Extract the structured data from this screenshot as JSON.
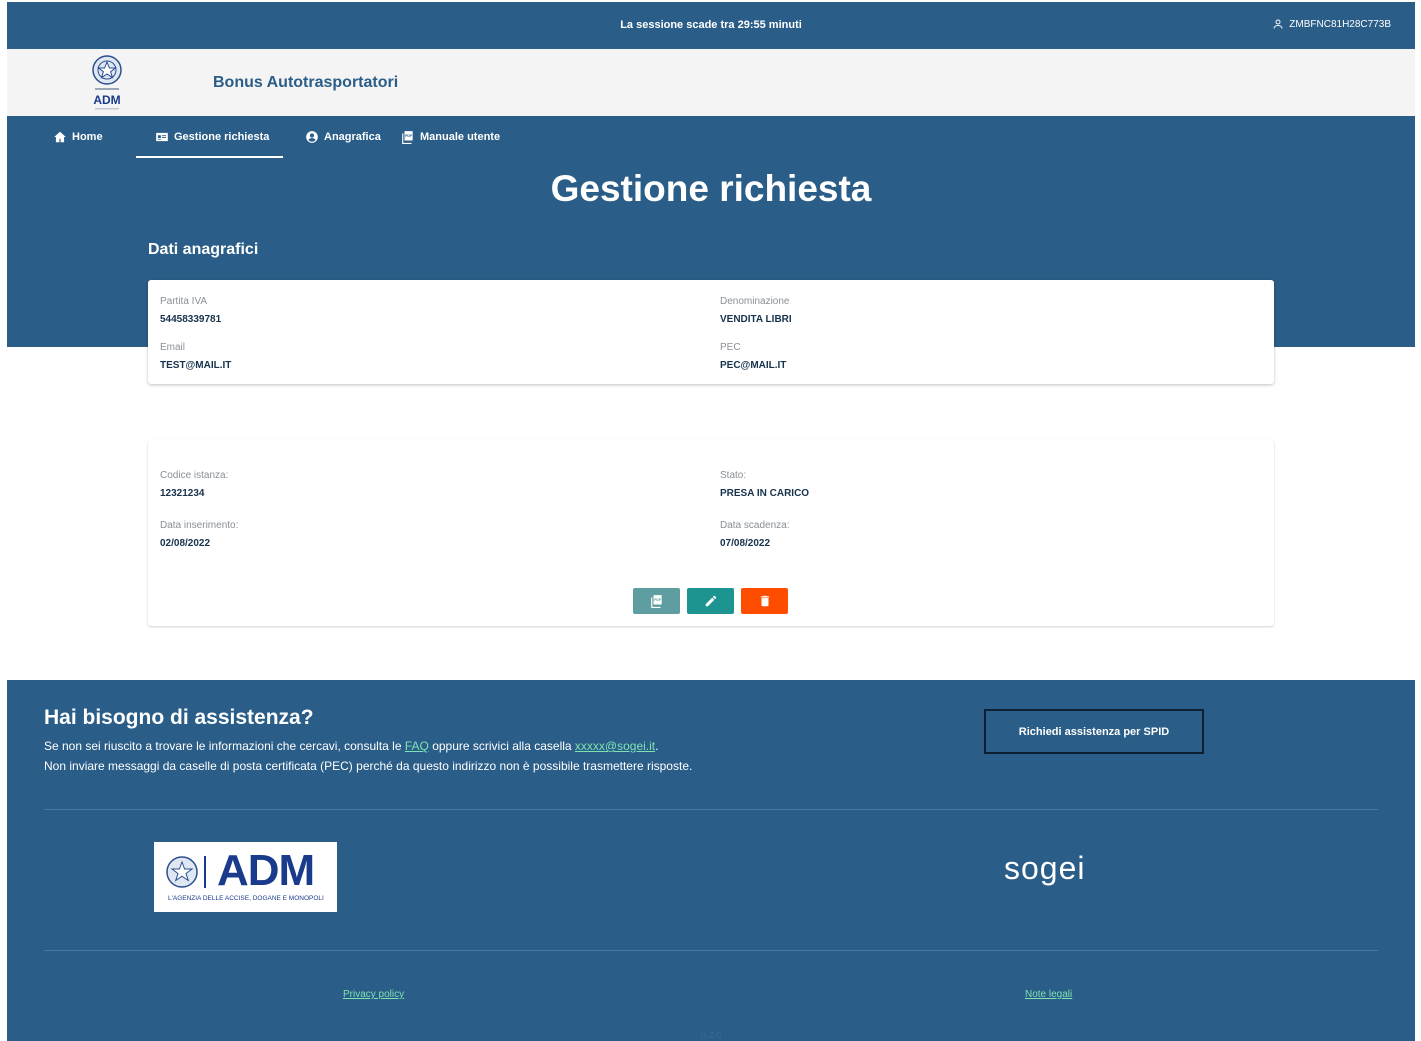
{
  "session": {
    "text": "La sessione scade tra 29:55 minuti",
    "user_code": "ZMBFNC81H28C773B"
  },
  "brand": {
    "logo_text": "ADM",
    "app_title": "Bonus Autotrasportatori"
  },
  "nav": {
    "items": [
      {
        "label": "Home",
        "icon": "home-icon"
      },
      {
        "label": "Gestione richiesta",
        "icon": "id-card-icon",
        "active": true
      },
      {
        "label": "Anagrafica",
        "icon": "user-circle-icon"
      },
      {
        "label": "Manuale utente",
        "icon": "pdf-icon"
      }
    ]
  },
  "page": {
    "title": "Gestione richiesta",
    "section_title": "Dati anagrafici"
  },
  "anagrafica": {
    "partita_iva_label": "Partita IVA",
    "partita_iva": "54458339781",
    "denominazione_label": "Denominazione",
    "denominazione": "VENDITA LIBRI",
    "email_label": "Email",
    "email": "TEST@MAIL.IT",
    "pec_label": "PEC",
    "pec": "PEC@MAIL.IT"
  },
  "istanza": {
    "codice_label": "Codice istanza:",
    "codice": "12321234",
    "stato_label": "Stato:",
    "stato": "PRESA IN CARICO",
    "data_inserimento_label": "Data inserimento:",
    "data_inserimento": "02/08/2022",
    "data_scadenza_label": "Data scadenza:",
    "data_scadenza": "07/08/2022"
  },
  "colors": {
    "primary": "#2a5d87",
    "pdf_button": "#5f9ea0",
    "edit_button": "#1e9490",
    "delete_button": "#ff4d00",
    "link": "#7fe3b3"
  },
  "footer": {
    "help_title": "Hai bisogno di assistenza?",
    "help_line1_pre": "Se non sei riuscito a trovare le informazioni che cercavi, consulta le ",
    "faq_link": "FAQ",
    "help_line1_mid": " oppure scrivici alla casella ",
    "email_link": "xxxxx@sogei.it",
    "help_line1_post": ".",
    "help_line2": "Non inviare messaggi da caselle di posta certificata (PEC) perché da questo indirizzo non è possibile trasmettere risposte.",
    "spid_button": "Richiedi assistenza per SPID",
    "adm_logo_text": "ADM",
    "adm_logo_subtitle": "L'AGENZIA DELLE ACCISE, DOGANE E MONOPOLI",
    "sogei_logo_text": "sogei",
    "privacy_link": "Privacy policy",
    "legal_link": "Note legali",
    "version": "0.2.0"
  }
}
